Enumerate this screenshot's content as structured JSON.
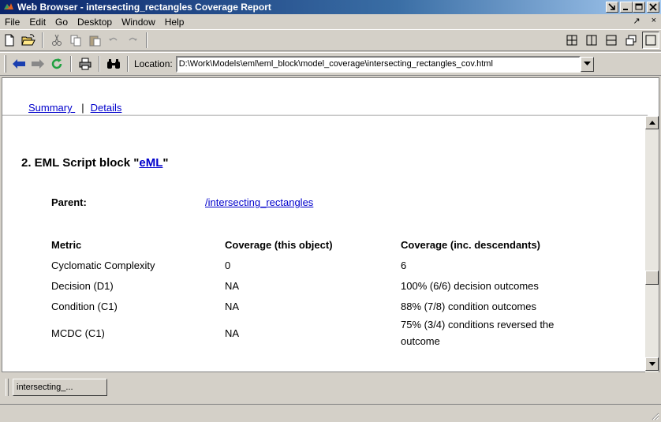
{
  "window": {
    "title": "Web Browser - intersecting_rectangles Coverage Report",
    "icon": "matlab-logo-icon",
    "controls": {
      "undock": "↘",
      "minimize": "_",
      "maximize": "□",
      "close": "×"
    }
  },
  "menubar": {
    "items": [
      "File",
      "Edit",
      "Go",
      "Desktop",
      "Window",
      "Help"
    ],
    "right_undock": "↗",
    "right_close": "×"
  },
  "toolbar1": {
    "icons": [
      "new-page-icon",
      "open-folder-icon",
      "cut-icon",
      "copy-icon",
      "paste-icon",
      "undo-icon",
      "redo-icon"
    ],
    "layout_icons": [
      "tile-grid-icon",
      "tile-columns-icon",
      "tile-rows-icon",
      "float-icon",
      "maximize-layout-icon"
    ]
  },
  "toolbar2": {
    "icons": [
      "back-arrow-icon",
      "forward-arrow-icon",
      "refresh-icon",
      "print-icon",
      "find-icon"
    ],
    "location_label": "Location:",
    "location_value": "D:\\Work\\Models\\eml\\eml_block\\model_coverage\\intersecting_rectangles_cov.html"
  },
  "page": {
    "nav": {
      "summary": "Summary ",
      "separator": "|",
      "details": "Details "
    },
    "heading_prefix": "2. EML Script block \"",
    "heading_link": "eML",
    "heading_suffix": "\"",
    "parent_label": "Parent:",
    "parent_link": "/intersecting_rectangles",
    "columns": [
      "Metric",
      "Coverage (this object)",
      "Coverage (inc. descendants)"
    ],
    "rows": [
      {
        "metric": "Cyclomatic Complexity",
        "this": "0",
        "inc": "6"
      },
      {
        "metric": "Decision (D1)",
        "this": "NA",
        "inc": "100% (6/6) decision outcomes"
      },
      {
        "metric": "Condition (C1)",
        "this": "NA",
        "inc": "88% (7/8) condition outcomes"
      },
      {
        "metric": "MCDC (C1)",
        "this": "NA",
        "inc_line1": "75% (3/4) conditions reversed the",
        "inc_line2": "outcome"
      }
    ]
  },
  "tabs": [
    {
      "label": "intersecting_..."
    }
  ]
}
